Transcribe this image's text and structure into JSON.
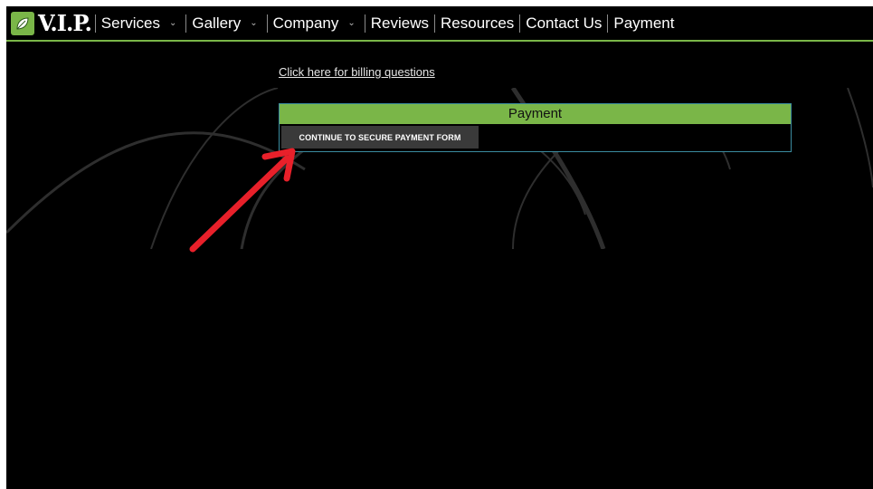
{
  "brand": {
    "logo_text": "V.I.P.",
    "accent_color": "#7ab648"
  },
  "nav": {
    "items": [
      {
        "label": "Services",
        "has_dropdown": true
      },
      {
        "label": "Gallery",
        "has_dropdown": true
      },
      {
        "label": "Company",
        "has_dropdown": true
      },
      {
        "label": "Reviews",
        "has_dropdown": false
      },
      {
        "label": "Resources",
        "has_dropdown": false
      },
      {
        "label": "Contact Us",
        "has_dropdown": false
      },
      {
        "label": "Payment",
        "has_dropdown": false
      }
    ],
    "dropdown_icon": "chevron-down-icon"
  },
  "main": {
    "billing_link": "Click here for billing questions",
    "payment": {
      "title": "Payment",
      "button_label": "CONTINUE TO SECURE PAYMENT FORM"
    }
  },
  "annotation": {
    "icon": "red-arrow-icon",
    "color": "#e8202a"
  }
}
